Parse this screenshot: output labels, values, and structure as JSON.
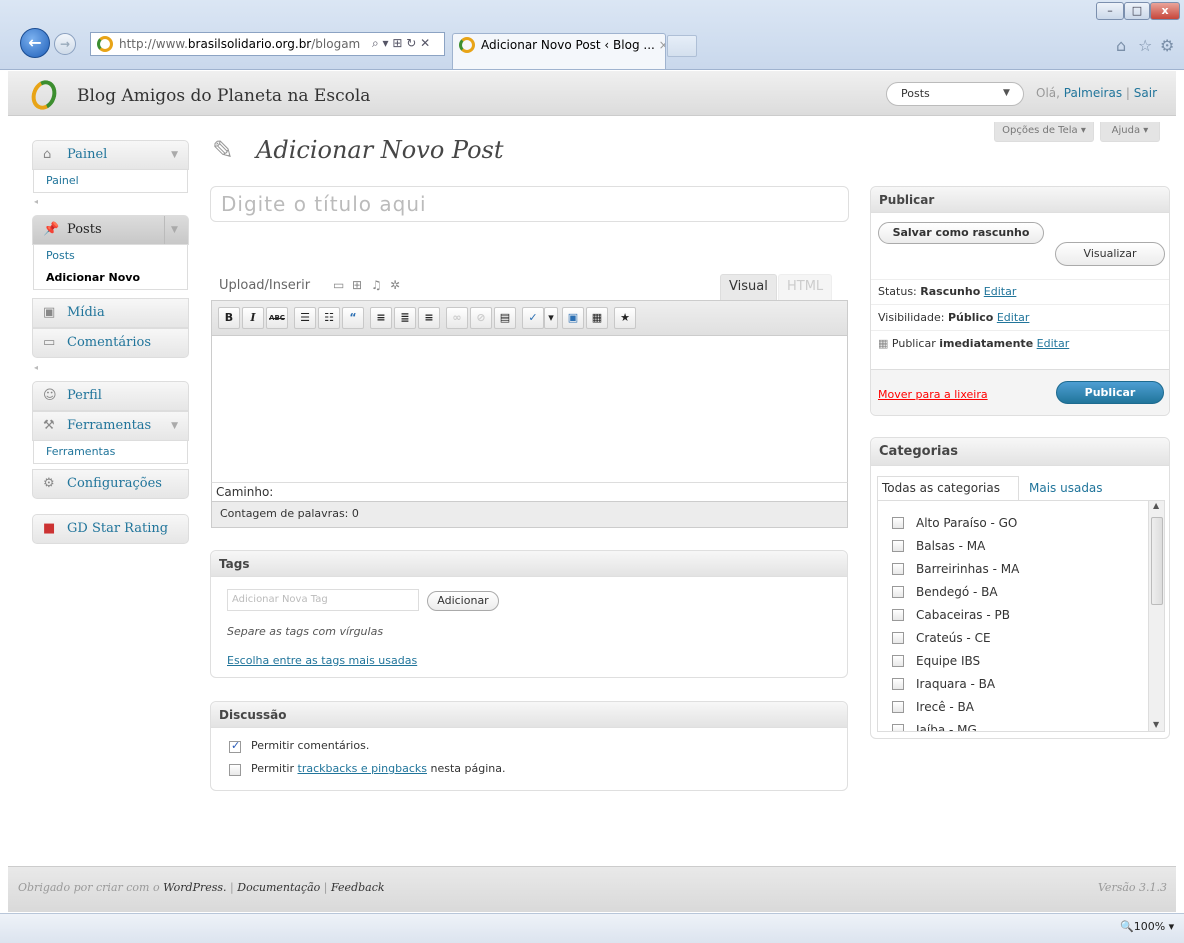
{
  "browser": {
    "address": "http://www.",
    "address_bold": "brasilsolidario.org.br",
    "address_rest": "/blogam",
    "address_tools": "⌕ ▾ ⊞ ↻ ✕",
    "tab_title": "Adicionar Novo Post ‹ Blog ...",
    "tab_close": "×",
    "window_min": "–",
    "window_max": "□",
    "window_close": "x",
    "home_icon": "⌂",
    "star_icon": "☆",
    "gear_icon": "⚙",
    "zoom": "100%",
    "zoom_icon": "🔍"
  },
  "header": {
    "blog_title": "Blog Amigos do Planeta na Escola",
    "favorites_selected": "Posts",
    "greeting": "Olá, ",
    "user": "Palmeiras",
    "separator": " | ",
    "logout": "Sair"
  },
  "screen_options": {
    "options": "Opções de Tela ▾",
    "help": "Ajuda ▾"
  },
  "sidebar": {
    "painel": "Painel",
    "painel_sub": "Painel",
    "posts": "Posts",
    "posts_sub_1": "Posts",
    "posts_sub_2": "Adicionar Novo",
    "midia": "Mídia",
    "comentarios": "Comentários",
    "perfil": "Perfil",
    "ferramentas": "Ferramentas",
    "ferramentas_sub": "Ferramentas",
    "config": "Configurações",
    "gd": "GD Star Rating"
  },
  "main": {
    "page_title": "Adicionar Novo Post",
    "title_placeholder": "Digite o título aqui",
    "upload_label": "Upload/Inserir",
    "tab_visual": "Visual",
    "tab_html": "HTML",
    "path_label": "Caminho:",
    "word_count": "Contagem de palavras: 0"
  },
  "toolbar": [
    "B",
    "I",
    "ABC",
    "☰",
    "☷",
    "“",
    "≡",
    "≣",
    "≡",
    "∞",
    "⊘",
    "▤",
    "✓",
    "▾",
    "▣",
    "▦",
    "★"
  ],
  "tags": {
    "title": "Tags",
    "placeholder": "Adicionar Nova Tag",
    "add_button": "Adicionar",
    "hint": "Separe as tags com vírgulas",
    "choose_link": "Escolha entre as tags mais usadas"
  },
  "discussion": {
    "title": "Discussão",
    "allow_comments": "Permitir comentários.",
    "allow_comments_checked": true,
    "allow_prefix": "Permitir ",
    "trackbacks_link": "trackbacks e pingbacks",
    "allow_suffix": " nesta página."
  },
  "publish": {
    "title": "Publicar",
    "save_draft": "Salvar como rascunho",
    "preview": "Visualizar",
    "status_label": "Status: ",
    "status_value": "Rascunho",
    "visibility_label": "Visibilidade: ",
    "visibility_value": "Público",
    "publish_label": "Publicar ",
    "publish_value": "imediatamente",
    "edit": "Editar",
    "trash": "Mover para a lixeira",
    "publish_button": "Publicar"
  },
  "categories": {
    "title": "Categorias",
    "tab_all": "Todas as categorias",
    "tab_popular": "Mais usadas",
    "items": [
      "Alto Paraíso - GO",
      "Balsas - MA",
      "Barreirinhas - MA",
      "Bendegó - BA",
      "Cabaceiras - PB",
      "Crateús - CE",
      "Equipe IBS",
      "Iraquara - BA",
      "Irecê - BA",
      "Jaíba - MG"
    ]
  },
  "footer": {
    "thanks": "Obrigado por criar com o ",
    "wordpress": "WordPress.",
    "docs": "Documentação",
    "feedback": "Feedback",
    "version": "Versão 3.1.3"
  }
}
